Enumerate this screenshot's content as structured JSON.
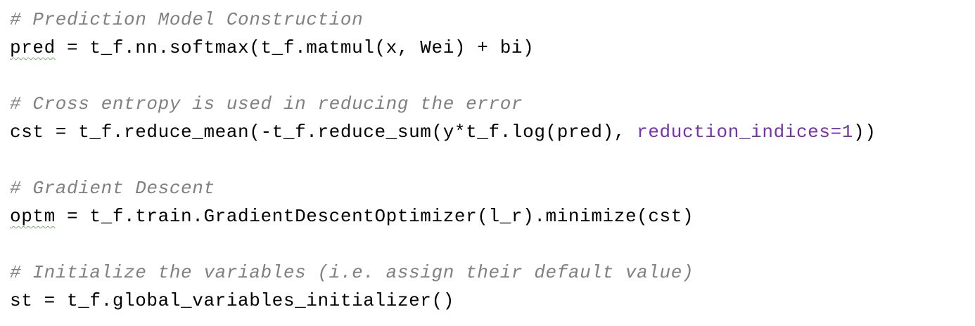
{
  "code": {
    "comment1": "# Prediction Model Construction",
    "line1_var": "pred",
    "line1_rest": " = t_f.nn.softmax(t_f.matmul(x, Wei) + bi)",
    "comment2": "# Cross entropy is used in reducing the error",
    "line2_start": "cst = t_f.reduce_mean(-t_f.reduce_sum(y*t_f.log(pred), ",
    "line2_kwarg": "reduction_indices=1",
    "line2_end": "))",
    "comment3": "# Gradient Descent",
    "line3_var": "optm",
    "line3_rest": " = t_f.train.GradientDescentOptimizer(l_r).minimize(cst)",
    "comment4": "# Initialize the variables (i.e. assign their default value)",
    "line4": "st = t_f.global_variables_initializer()"
  },
  "colors": {
    "comment": "#808080",
    "keyword_arg": "#7a2fb3",
    "spellcheck_underline": "#6fb06f",
    "text": "#000000",
    "background": "#ffffff"
  }
}
